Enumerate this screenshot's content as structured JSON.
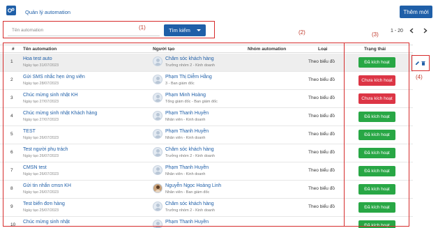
{
  "header": {
    "app_title": "Quản lý automation",
    "new_button": "Thêm mới"
  },
  "filter": {
    "search_placeholder": "Tên automation",
    "search_button": "Tìm kiếm",
    "pagination_range": "1 - 20"
  },
  "annotations": [
    "(1)",
    "(2)",
    "(3)",
    "(4)"
  ],
  "table": {
    "columns": [
      "#",
      "Tên automation",
      "Người tạo",
      "Nhóm automation",
      "Loại",
      "Trạng thái"
    ],
    "rows": [
      {
        "idx": "1",
        "name": "Hoa test auto",
        "date": "Ngày tạo 31/07/2023",
        "user": "Chăm sóc khách hàng",
        "role": "Trưởng nhóm 2 - Kinh doanh",
        "type": "Theo biểu đồ",
        "status": "Đã kích hoạt",
        "active": true,
        "photo": false
      },
      {
        "idx": "2",
        "name": "Gửi SMS nhắc hẹn ứng viên",
        "date": "Ngày tạo 28/07/2023",
        "user": "Phạm Thị Diễm Hằng",
        "role": "3 - Ban giám đốc",
        "type": "Theo biểu đồ",
        "status": "Chưa kích hoạt",
        "active": false,
        "photo": false
      },
      {
        "idx": "3",
        "name": "Chúc mừng sinh nhật KH",
        "date": "Ngày tạo 27/07/2023",
        "user": "Phạm Minh Hoàng",
        "role": "Tổng giám đốc - Ban giám đốc",
        "type": "Theo biểu đồ",
        "status": "Chưa kích hoạt",
        "active": false,
        "photo": false
      },
      {
        "idx": "4",
        "name": "Chúc mừng sinh nhật Khách hàng",
        "date": "Ngày tạo 27/07/2023",
        "user": "Phạm Thanh Huyền",
        "role": "Nhân viên - Kinh doanh",
        "type": "Theo biểu đồ",
        "status": "Đã kích hoạt",
        "active": true,
        "photo": false
      },
      {
        "idx": "5",
        "name": "TEST",
        "date": "Ngày tạo 26/07/2023",
        "user": "Phạm Thanh Huyền",
        "role": "Nhân viên - Kinh doanh",
        "type": "Theo biểu đồ",
        "status": "Đã kích hoạt",
        "active": true,
        "photo": false
      },
      {
        "idx": "6",
        "name": "Test người phụ trách",
        "date": "Ngày tạo 26/07/2023",
        "user": "Chăm sóc khách hàng",
        "role": "Trưởng nhóm 2 - Kinh doanh",
        "type": "Theo biểu đồ",
        "status": "Đã kích hoạt",
        "active": true,
        "photo": false
      },
      {
        "idx": "7",
        "name": "CMSN test",
        "date": "Ngày tạo 26/07/2023",
        "user": "Phạm Thanh Huyền",
        "role": "Nhân viên - Kinh doanh",
        "type": "Theo biểu đồ",
        "status": "Đã kích hoạt",
        "active": true,
        "photo": false
      },
      {
        "idx": "8",
        "name": "Gửi tin nhắn cmsn KH",
        "date": "Ngày tạo 26/07/2023",
        "user": "Nguyễn Ngọc Hoàng Linh",
        "role": "Nhân viên - Ban giám đốc",
        "type": "Theo biểu đồ",
        "status": "Đã kích hoạt",
        "active": true,
        "photo": true
      },
      {
        "idx": "9",
        "name": "Test biến đơn hàng",
        "date": "Ngày tạo 25/07/2023",
        "user": "Chăm sóc khách hàng",
        "role": "Trưởng nhóm 2 - Kinh doanh",
        "type": "Theo biểu đồ",
        "status": "Đã kích hoạt",
        "active": true,
        "photo": false
      },
      {
        "idx": "10",
        "name": "Chúc mừng sinh nhật",
        "date": "",
        "user": "Phạm Thanh Huyền",
        "role": "",
        "type": "",
        "status": "Đã kích hoạt",
        "active": true,
        "photo": false
      }
    ]
  },
  "colors": {
    "primary": "#1f5fa8",
    "active": "#28a745",
    "inactive": "#dc3545",
    "annotation": "#d62b2b"
  }
}
